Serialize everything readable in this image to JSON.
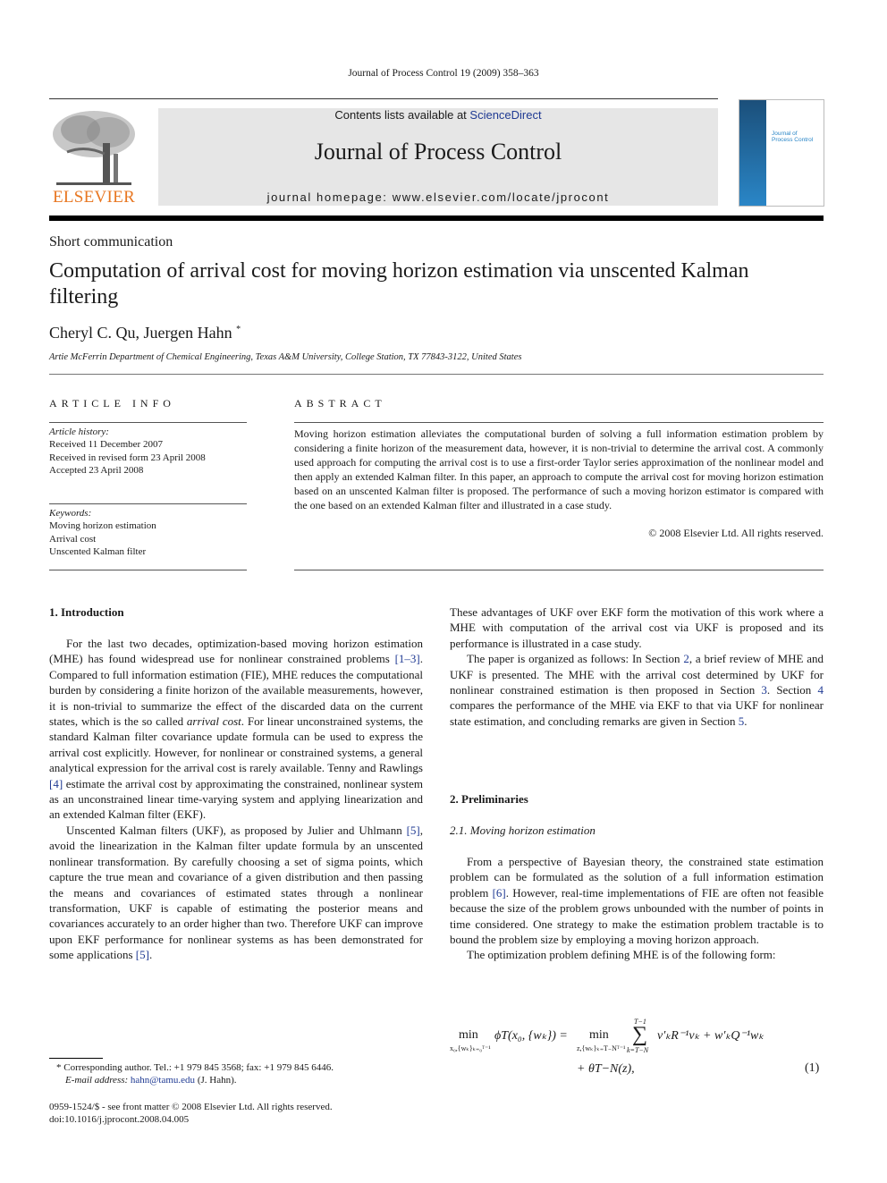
{
  "header": {
    "running_head": "Journal of Process Control 19 (2009) 358–363",
    "contents_prefix": "Contents lists available at ",
    "contents_link": "ScienceDirect",
    "journal_title": "Journal of Process Control",
    "homepage": "journal homepage: www.elsevier.com/locate/jprocont",
    "publisher_logo_text": "ELSEVIER",
    "cover_title_line1": "Journal of",
    "cover_title_line2": "Process Control"
  },
  "colors": {
    "link": "#1f3a93",
    "elsevier_orange": "#e87722",
    "banner_bg": "#e6e6e6"
  },
  "article": {
    "type": "Short communication",
    "title": "Computation of arrival cost for moving horizon estimation via unscented Kalman filtering",
    "authors": "Cheryl C. Qu, Juergen Hahn",
    "author_mark": "*",
    "affiliation": "Artie McFerrin Department of Chemical Engineering, Texas A&M University, College Station, TX 77843-3122, United States"
  },
  "article_info": {
    "heading": "ARTICLE INFO",
    "history_label": "Article history:",
    "history": [
      "Received 11 December 2007",
      "Received in revised form 23 April 2008",
      "Accepted 23 April 2008"
    ],
    "keywords_label": "Keywords:",
    "keywords": [
      "Moving horizon estimation",
      "Arrival cost",
      "Unscented Kalman filter"
    ]
  },
  "abstract": {
    "heading": "ABSTRACT",
    "text": "Moving horizon estimation alleviates the computational burden of solving a full information estimation problem by considering a finite horizon of the measurement data, however, it is non-trivial to determine the arrival cost. A commonly used approach for computing the arrival cost is to use a first-order Taylor series approximation of the nonlinear model and then apply an extended Kalman filter. In this paper, an approach to compute the arrival cost for moving horizon estimation based on an unscented Kalman filter is proposed. The performance of such a moving horizon estimator is compared with the one based on an extended Kalman filter and illustrated in a case study.",
    "copyright": "© 2008 Elsevier Ltd. All rights reserved."
  },
  "body": {
    "intro_heading": "1. Introduction",
    "intro_p1": {
      "a": "For the last two decades, optimization-based moving horizon estimation (MHE) has found widespread use for nonlinear constrained problems ",
      "ref1": "[1–3]",
      "b": ". Compared to full information estimation (FIE), MHE reduces the computational burden by considering a finite horizon of the available measurements, however, it is non-trivial to summarize the effect of the discarded data on the current states, which is the so called ",
      "em": "arrival cost",
      "c": ". For linear unconstrained systems, the standard Kalman filter covariance update formula can be used to express the arrival cost explicitly. However, for nonlinear or constrained systems, a general analytical expression for the arrival cost is rarely available. Tenny and Rawlings ",
      "ref2": "[4]",
      "d": " estimate the arrival cost by approximating the constrained, nonlinear system as an unconstrained linear time-varying system and applying linearization and an extended Kalman filter (EKF)."
    },
    "intro_p2": {
      "a": "Unscented Kalman filters (UKF), as proposed by Julier and Uhlmann ",
      "ref1": "[5]",
      "b": ", avoid the linearization in the Kalman filter update formula by an unscented nonlinear transformation. By carefully choosing a set of sigma points, which capture the true mean and covariance of a given distribution and then passing the means and covariances of estimated states through a nonlinear transformation, UKF is capable of estimating the posterior means and covariances accurately to an order higher than two. Therefore UKF can improve upon EKF performance for nonlinear systems as has been demonstrated for some applications ",
      "ref2": "[5]",
      "c": "."
    },
    "intro_p3": "These advantages of UKF over EKF form the motivation of this work where a MHE with computation of the arrival cost via UKF is proposed and its performance is illustrated in a case study.",
    "intro_p4": {
      "a": "The paper is organized as follows: In Section ",
      "ref1": "2",
      "b": ", a brief review of MHE and UKF is presented. The MHE with the arrival cost determined by UKF for nonlinear constrained estimation is then proposed in Section ",
      "ref2": "3",
      "c": ". Section ",
      "ref3": "4",
      "d": " compares the performance of the MHE via EKF to that via UKF for nonlinear state estimation, and concluding remarks are given in Section ",
      "ref4": "5",
      "e": "."
    },
    "prelim_heading": "2. Preliminaries",
    "subsec_heading": "2.1. Moving horizon estimation",
    "mhe_p1": {
      "a": "From a perspective of Bayesian theory, the constrained state estimation problem can be formulated as the solution of a full information estimation problem ",
      "ref1": "[6]",
      "b": ". However, real-time implementations of FIE are often not feasible because the size of the problem grows unbounded with the number of points in time considered. One strategy to make the estimation problem tractable is to bound the problem size by employing a moving horizon approach."
    },
    "mhe_p2": "The optimization problem defining MHE is of the following form:",
    "equation": {
      "lhs_op": "min",
      "lhs_sub": "x₀,{wₖ}ₖ₌₀ᵀ⁻¹",
      "lhs": "ϕT(x₀, {wₖ}) =",
      "rhs_op": "min",
      "rhs_sub": "z,{wₖ}ₖ₌T₋Nᵀ⁻¹",
      "sum_top": "T−1",
      "sum_bottom": "k=T−N",
      "summand": "v′ₖR⁻¹vₖ + w′ₖQ⁻¹wₖ",
      "line2": "+ θT−N(z),",
      "number": "(1)"
    }
  },
  "footnote": {
    "mark": "*",
    "text": "Corresponding author. Tel.: +1 979 845 3568; fax: +1 979 845 6446.",
    "email_label": "E-mail address:",
    "email": "hahn@tamu.edu",
    "email_suffix": " (J. Hahn)."
  },
  "front_matter": {
    "line1": "0959-1524/$ - see front matter © 2008 Elsevier Ltd. All rights reserved.",
    "doi": "doi:10.1016/j.jprocont.2008.04.005"
  }
}
